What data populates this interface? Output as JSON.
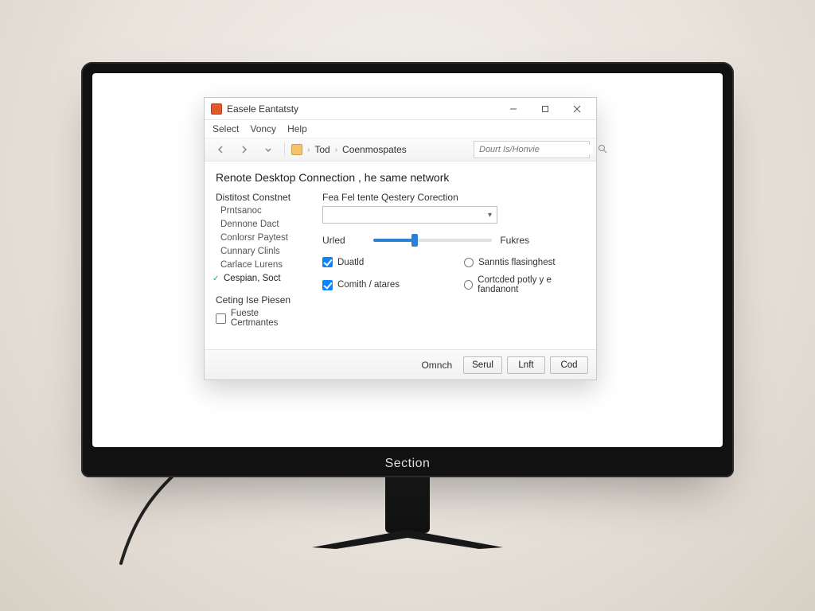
{
  "monitor": {
    "brand": "Section"
  },
  "window": {
    "title": "Easele Eantatsty",
    "menu": [
      "Select",
      "Voncy",
      "Help"
    ],
    "toolbar": {
      "breadcrumb_item1": "Tod",
      "breadcrumb_item2": "Coenmospates",
      "search_placeholder": "Dourt Is/Honvie"
    },
    "heading": "Renote Desktop Connection , he same network",
    "sidepanel": {
      "group1_title": "Distitost Constnet",
      "group1_items": [
        "Prntsanoc",
        "Dennone Dact",
        "Conlorsr Paytest",
        "Cunnary Clinls",
        "Carlace Lurens",
        "Cespian, Soct"
      ],
      "group1_selected_index": 5,
      "group2_title": "Ceting Ise Piesen",
      "group2_checkbox_label": "Fueste Certmantes",
      "group2_checkbox_checked": false
    },
    "main": {
      "field1_label": "Fea Fel tente Qestery Corection",
      "dropdown_value": "",
      "slider": {
        "left_label": "Urled",
        "right_label": "Fukres",
        "percent": 35
      },
      "options": {
        "cb1": {
          "label": "Duatld",
          "checked": true
        },
        "cb2": {
          "label": "Comith / atares",
          "checked": true
        },
        "r1": {
          "label": "Sanntis flasinghest"
        },
        "r2": {
          "label": "Cortcded potly y e fandanont"
        }
      }
    },
    "footer": {
      "link": "Omnch",
      "buttons": [
        "Serul",
        "Lnft",
        "Cod"
      ]
    }
  }
}
